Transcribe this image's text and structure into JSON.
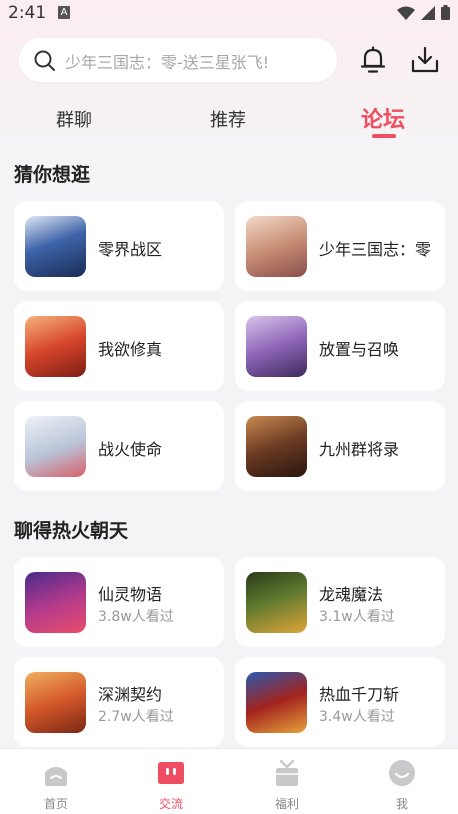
{
  "status_bar": {
    "time": "2:41",
    "badge": "A"
  },
  "search": {
    "placeholder": "少年三国志：零-送三星张飞!"
  },
  "tabs": [
    {
      "label": "群聊",
      "active": false
    },
    {
      "label": "推荐",
      "active": false
    },
    {
      "label": "论坛",
      "active": true
    }
  ],
  "section_guess": {
    "title": "猜你想逛",
    "items": [
      {
        "name": "零界战区",
        "thumb_color": "#2b4a8a"
      },
      {
        "name": "少年三国志：零",
        "thumb_color": "#d9a98f"
      },
      {
        "name": "我欲修真",
        "thumb_color": "#c8452d"
      },
      {
        "name": "放置与召唤",
        "thumb_color": "#7a5aa8"
      },
      {
        "name": "战火使命",
        "thumb_color": "#c9d4e6"
      },
      {
        "name": "九州群将录",
        "thumb_color": "#6a3a22"
      }
    ]
  },
  "section_hot": {
    "title": "聊得热火朝天",
    "items": [
      {
        "name": "仙灵物语",
        "views": "3.8w人看过",
        "thumb_color": "#7b3aa6"
      },
      {
        "name": "龙魂魔法",
        "views": "3.1w人看过",
        "thumb_color": "#3d5a2a"
      },
      {
        "name": "深渊契约",
        "views": "2.7w人看过",
        "thumb_color": "#c4552a"
      },
      {
        "name": "热血千刀斩",
        "views": "3.4w人看过",
        "thumb_color": "#a3231e"
      }
    ]
  },
  "bottom_nav": [
    {
      "label": "首页",
      "icon": "home-icon",
      "active": false
    },
    {
      "label": "交流",
      "icon": "chat-icon",
      "active": true
    },
    {
      "label": "福利",
      "icon": "gift-icon",
      "active": false
    },
    {
      "label": "我",
      "icon": "profile-icon",
      "active": false
    }
  ],
  "colors": {
    "accent": "#ef4d62",
    "inactive": "#c9c9cc"
  }
}
